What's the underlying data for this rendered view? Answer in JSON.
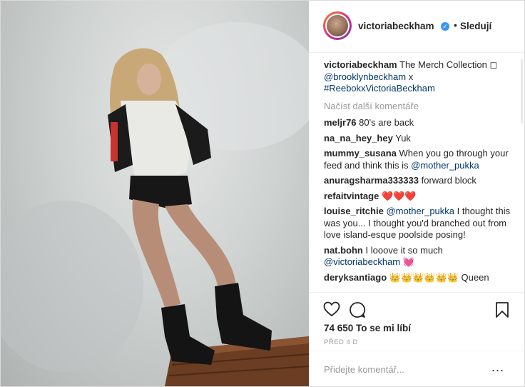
{
  "post": {
    "username": "victoriabeckham",
    "follow_label": "Sledují",
    "caption": {
      "username": "victoriabeckham",
      "text": "The Merch Collection ◻",
      "mention": "@brooklynbeckham",
      "join": "x",
      "hashtag": "#ReebokxVictoriaBeckham"
    },
    "load_more_label": "Načíst další komentáře",
    "comments": [
      {
        "user": "meljr76",
        "text": "80's are back"
      },
      {
        "user": "na_na_hey_hey",
        "text": "Yuk"
      },
      {
        "user": "mummy_susana",
        "text": "When you go through your feed and think this is",
        "mention": "@mother_pukka"
      },
      {
        "user": "anuragsharma333333",
        "text": "forward block"
      },
      {
        "user": "refaitvintage",
        "text": "❤️❤️❤️"
      },
      {
        "user": "louise_ritchie",
        "mention": "@mother_pukka",
        "text": "I thought this was you... I thought you'd branched out from love island-esque poolside posing!"
      },
      {
        "user": "nat.bohn",
        "text": "I looove it so much",
        "mention": "@victoriabeckham",
        "tail": "💓"
      },
      {
        "user": "deryksantiago",
        "text": "👑👑👑👑👑👑 Queen"
      }
    ],
    "likes_label": "74 650 To se mi líbí",
    "time_label": "PŘED 4 D",
    "add_comment_placeholder": "Přidejte komentář...",
    "more_options": "..."
  },
  "icons": [
    "verified-badge-icon",
    "heart-icon",
    "comment-icon",
    "bookmark-icon",
    "more-options-icon"
  ],
  "colors": {
    "link": "#003569",
    "verified": "#3897f0",
    "muted": "#999999"
  }
}
